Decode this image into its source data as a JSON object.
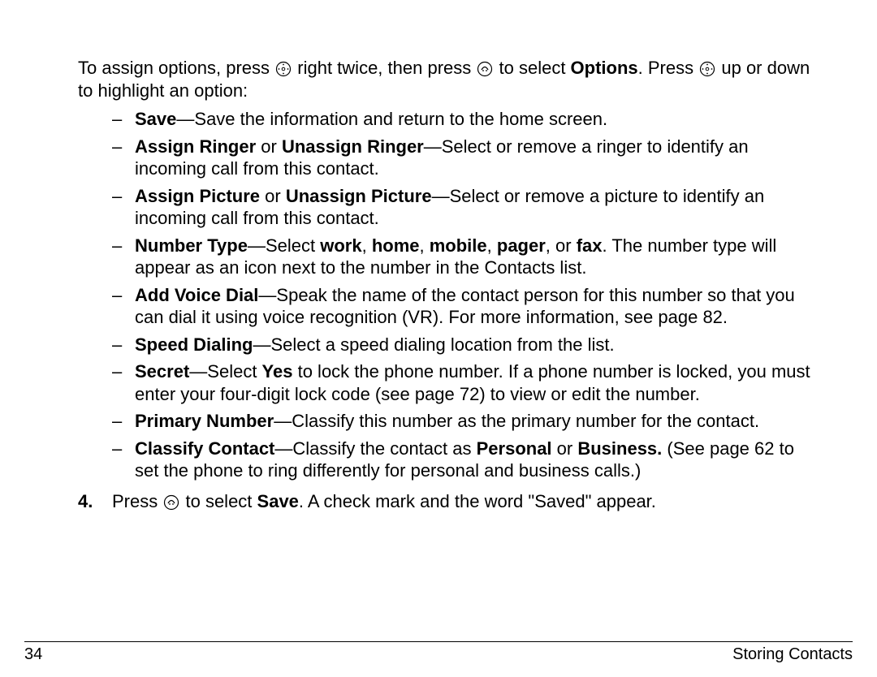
{
  "intro": {
    "p1a": "To assign options, press ",
    "p1b": " right twice, then press ",
    "p1c": " to select ",
    "p1d": "Options",
    "p1e": ". Press ",
    "p1f": " up or down to highlight an option:"
  },
  "options": {
    "save": {
      "label": "Save",
      "desc": "—Save the information and return to the home screen."
    },
    "ringer": {
      "label1": "Assign Ringer",
      "or": " or ",
      "label2": "Unassign Ringer",
      "desc": "—Select or remove a ringer to identify an incoming call from this contact."
    },
    "picture": {
      "label1": "Assign Picture",
      "or": " or ",
      "label2": "Unassign Picture",
      "desc": "—Select or remove a picture to identify an incoming call from this contact."
    },
    "numtype": {
      "label": "Number Type",
      "d1": "—Select ",
      "w": "work",
      "c1": ", ",
      "h": "home",
      "c2": ", ",
      "m": "mobile",
      "c3": ", ",
      "p": "pager",
      "c4": ", or ",
      "f": "fax",
      "d2": ". The number type will appear as an icon next to the number in the Contacts list."
    },
    "voice": {
      "label": "Add Voice Dial",
      "desc": "—Speak the name of the contact person for this number so that you can dial it using voice recognition (VR). For more information, see page 82."
    },
    "speed": {
      "label": "Speed Dialing",
      "desc": "—Select a speed dialing location from the list."
    },
    "secret": {
      "label": "Secret",
      "d1": "—Select ",
      "yes": "Yes",
      "d2": " to lock the phone number. If a phone number is locked, you must enter your four-digit lock code (see page 72) to view or edit the number."
    },
    "primary": {
      "label": "Primary Number",
      "desc": "—Classify this number as the primary number for the contact."
    },
    "classify": {
      "label": "Classify Contact",
      "d1": "—Classify the contact as ",
      "p": "Personal",
      "or": " or ",
      "b": "Business.",
      "d2": " (See page 62 to set the phone to ring differently for personal and business calls.)"
    }
  },
  "step4": {
    "num": "4.",
    "a": "Press ",
    "b": " to select ",
    "save": "Save",
    "c": ". A check mark and the word \"Saved\" appear."
  },
  "footer": {
    "page": "34",
    "section": "Storing Contacts"
  }
}
